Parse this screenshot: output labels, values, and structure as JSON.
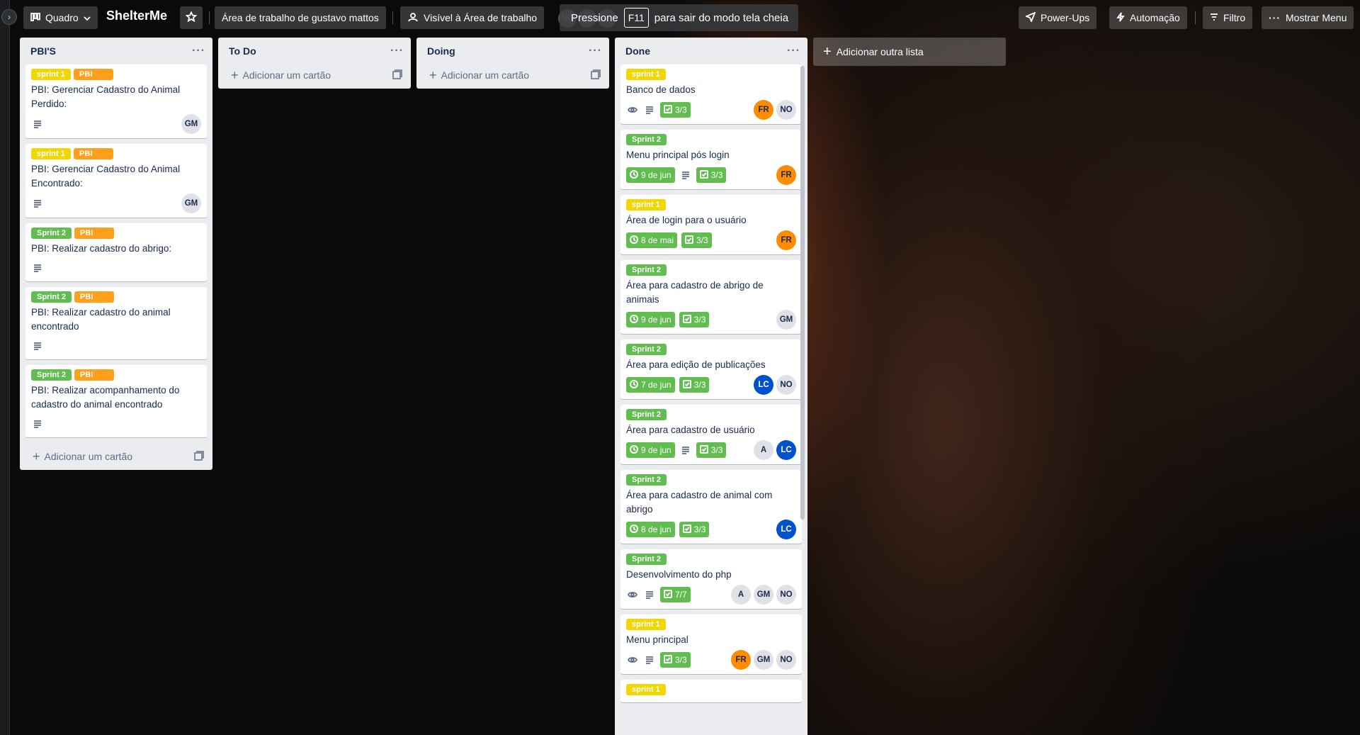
{
  "header": {
    "board_switcher": "Quadro",
    "board_name": "ShelterMe",
    "workspace": "Área de trabalho de gustavo mattos",
    "visibility": "Visível à Área de trabalho",
    "fullscreen_notice": {
      "prefix": "Pressione",
      "key": "F11",
      "suffix": "para sair do modo tela cheia"
    },
    "ghost_avatar": "NO",
    "power_ups": "Power-Ups",
    "automation": "Automação",
    "filter": "Filtro",
    "show_menu": "Mostrar Menu"
  },
  "add_card_label": "Adicionar um cartão",
  "add_list_label": "Adicionar outra lista",
  "lists": [
    {
      "title": "PBI'S",
      "cards": [
        {
          "labels": [
            "sprint 1",
            "PBI"
          ],
          "title": "PBI: Gerenciar Cadastro do Animal Perdido:",
          "members": [
            "GM"
          ]
        },
        {
          "labels": [
            "sprint 1",
            "PBI"
          ],
          "title": "PBI: Gerenciar Cadastro do Animal Encontrado:",
          "members": [
            "GM"
          ]
        },
        {
          "labels": [
            "Sprint 2",
            "PBI"
          ],
          "title": "PBI: Realizar cadastro do abrigo:",
          "members": []
        },
        {
          "labels": [
            "Sprint 2",
            "PBI"
          ],
          "title": "PBI: Realizar cadastro do animal encontrado",
          "members": []
        },
        {
          "labels": [
            "Sprint 2",
            "PBI"
          ],
          "title": "PBI: Realizar acompanhamento do cadastro do animal encontrado",
          "members": []
        }
      ]
    },
    {
      "title": "To Do",
      "cards": []
    },
    {
      "title": "Doing",
      "cards": []
    },
    {
      "title": "Done",
      "cards": [
        {
          "labels": [
            "sprint 1"
          ],
          "title": "Banco de dados",
          "due": "",
          "checklist": "3/3",
          "members": [
            "FR",
            "NO"
          ]
        },
        {
          "labels": [
            "Sprint 2"
          ],
          "title": "Menu principal pós login",
          "due": "9 de jun",
          "checklist": "3/3",
          "members": [
            "FR"
          ]
        },
        {
          "labels": [
            "sprint 1"
          ],
          "title": "Área de login para o usuário",
          "due": "8 de mai",
          "checklist": "3/3",
          "members": [
            "FR"
          ]
        },
        {
          "labels": [
            "Sprint 2"
          ],
          "title": "Área para cadastro de abrigo de animais",
          "due": "9 de jun",
          "checklist": "3/3",
          "members": [
            "GM"
          ]
        },
        {
          "labels": [
            "Sprint 2"
          ],
          "title": "Área para edição de publicações",
          "due": "7 de jun",
          "checklist": "3/3",
          "members": [
            "LC",
            "NO"
          ]
        },
        {
          "labels": [
            "Sprint 2"
          ],
          "title": "Área para cadastro de usuário",
          "due": "9 de jun",
          "checklist": "3/3",
          "members": [
            "A",
            "LC"
          ]
        },
        {
          "labels": [
            "Sprint 2"
          ],
          "title": "Área para cadastro de animal com abrigo",
          "due": "8 de jun",
          "checklist": "3/3",
          "members": [
            "LC"
          ]
        },
        {
          "labels": [
            "Sprint 2"
          ],
          "title": "Desenvolvimento do php",
          "due": "",
          "checklist": "7/7",
          "members": [
            "A",
            "GM",
            "NO"
          ]
        },
        {
          "labels": [
            "sprint 1"
          ],
          "title": "Menu principal",
          "due": "",
          "checklist": "3/3",
          "members": [
            "FR",
            "GM",
            "NO"
          ]
        },
        {
          "labels": [
            "sprint 1"
          ],
          "title": "",
          "due": "",
          "checklist": "",
          "members": []
        }
      ]
    }
  ],
  "colors": {
    "label_sprint1": "#f2d600",
    "label_sprint2": "#61bd4f",
    "label_pbi": "#ff9f1a",
    "member_FR": "#ff8b00",
    "member_LC": "#0052cc",
    "member_default": "#dfe1e6"
  }
}
